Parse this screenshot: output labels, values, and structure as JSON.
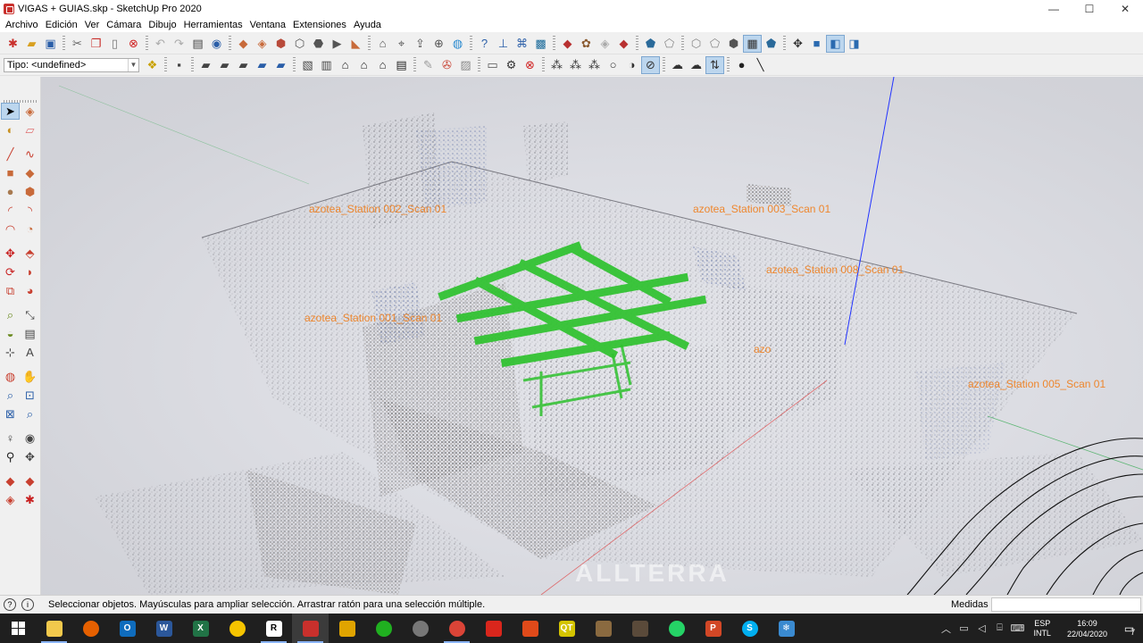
{
  "window": {
    "title": "VIGAS + GUIAS.skp - SketchUp Pro 2020",
    "controls": {
      "minimize": "—",
      "maximize": "☐",
      "close": "✕"
    }
  },
  "menu": [
    "Archivo",
    "Edición",
    "Ver",
    "Cámara",
    "Dibujo",
    "Herramientas",
    "Ventana",
    "Extensiones",
    "Ayuda"
  ],
  "toolbar2": {
    "type_label": "Tipo: <undefined>"
  },
  "viewport": {
    "scan_labels": [
      "azotea_Station 002_Scan 01",
      "azotea_Station 003_Scan 01",
      "azotea_Station 008_Scan 01",
      "azotea_Station 001_Scan 01",
      "azotea_Station 005_Scan 01",
      "azo"
    ],
    "watermark": "ALLTERRA",
    "colors": {
      "beams": "#2ec22e",
      "scan_label": "#f07d1a",
      "axis_blue": "#2233ff",
      "axis_red": "#e03a3a",
      "axis_green": "#2da84a"
    }
  },
  "status": {
    "text": "Seleccionar objetos. Mayúsculas para ampliar selección. Arrastrar ratón para una selección múltiple.",
    "measure_label": "Medidas",
    "measure_value": ""
  },
  "taskbar": {
    "apps": [
      {
        "icon": "file-explorer-icon",
        "color": "#f2c94c",
        "letter": ""
      },
      {
        "icon": "firefox-icon",
        "color": "#e66000",
        "letter": ""
      },
      {
        "icon": "outlook-icon",
        "color": "#0f6cbd",
        "letter": "O"
      },
      {
        "icon": "word-icon",
        "color": "#2b579a",
        "letter": "W"
      },
      {
        "icon": "excel-icon",
        "color": "#217346",
        "letter": "X"
      },
      {
        "icon": "norton-icon",
        "color": "#f5c400",
        "letter": ""
      },
      {
        "icon": "recap-icon",
        "color": "#ffffff",
        "letter": "R"
      },
      {
        "icon": "sketchup-icon",
        "color": "#c9302c",
        "letter": ""
      },
      {
        "icon": "autocad-icon",
        "color": "#e0a400",
        "letter": ""
      },
      {
        "icon": "green-app-icon",
        "color": "#20b020",
        "letter": ""
      },
      {
        "icon": "settings-app-icon",
        "color": "#777777",
        "letter": ""
      },
      {
        "icon": "chrome-icon",
        "color": "#db4437",
        "letter": ""
      },
      {
        "icon": "acrobat-icon",
        "color": "#d9261c",
        "letter": ""
      },
      {
        "icon": "red-app-icon",
        "color": "#e04a1a",
        "letter": ""
      },
      {
        "icon": "qt-icon",
        "color": "#d4c400",
        "letter": "QT"
      },
      {
        "icon": "scissors-app-icon",
        "color": "#8a6a40",
        "letter": ""
      },
      {
        "icon": "book-app-icon",
        "color": "#5a4a3a",
        "letter": ""
      },
      {
        "icon": "whatsapp-icon",
        "color": "#25d366",
        "letter": ""
      },
      {
        "icon": "powerpoint-icon",
        "color": "#d24726",
        "letter": "P"
      },
      {
        "icon": "skype-icon",
        "color": "#00aff0",
        "letter": "S"
      },
      {
        "icon": "snowflake-app-icon",
        "color": "#3a8ad0",
        "letter": "❄"
      }
    ],
    "lang_line1": "ESP",
    "lang_line2": "INTL",
    "time": "16:09",
    "date": "22/04/2020",
    "notifications": "7"
  }
}
